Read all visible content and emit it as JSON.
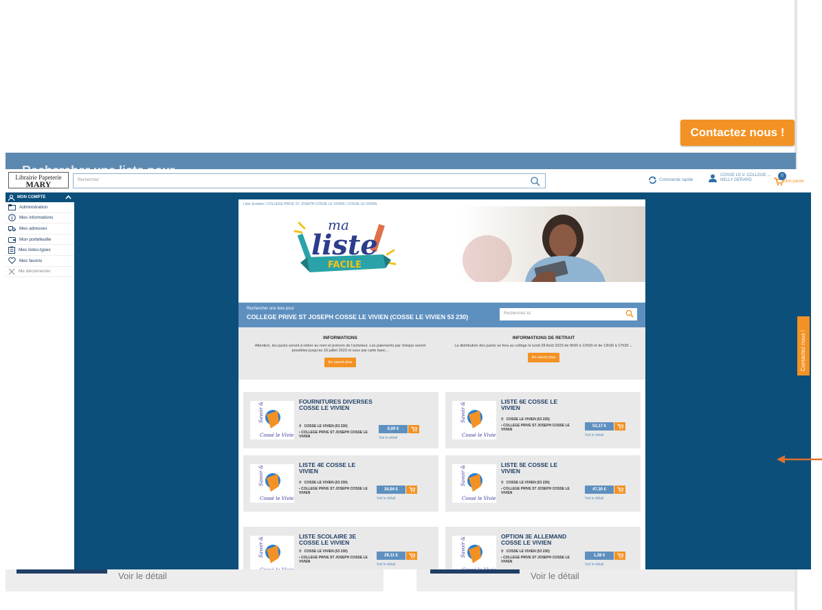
{
  "background": {
    "contact_button": "Contactez nous !",
    "band_heading": "Rechercher une liste pour",
    "bottom_links": [
      "Voir le détail",
      "Voir le détail"
    ]
  },
  "header": {
    "logo_line1": "Librairie Papeterie",
    "logo_line2": "MARY",
    "search_placeholder": "Rechercher",
    "quick_order": "Commande rapide",
    "user_line1": "COSSE LE V. COLLEGE ...",
    "user_line2": "NELLY GERARD",
    "cart_count": "0",
    "cart_label": "Mon panier"
  },
  "sidebar": {
    "header": "MON COMPTE",
    "items": [
      {
        "label": "Administration",
        "icon": "folder-icon"
      },
      {
        "label": "Mes informations",
        "icon": "info-icon"
      },
      {
        "label": "Mes adresses",
        "icon": "truck-icon"
      },
      {
        "label": "Mon portefeuille",
        "icon": "wallet-icon"
      },
      {
        "label": "Mes listes-types",
        "icon": "clipboard-icon"
      },
      {
        "label": "Mes favoris",
        "icon": "heart-icon"
      },
      {
        "label": "Me déconnecter",
        "icon": "close-icon"
      }
    ]
  },
  "main": {
    "breadcrumb": "Liste Scolaire / COLLEGE PRIVE ST JOSEPH COSSE LE VIVIEN / COSSE LE VIVIEN",
    "hero_logo": {
      "ma": "ma",
      "liste": "liste",
      "facile": "FACILE"
    },
    "search_prompt": "Rechercher une liste pour",
    "school_name": "COLLEGE PRIVE ST JOSEPH COSSE LE VIVIEN (COSSE LE VIVIEN 53 230)",
    "search_placeholder": "Recherchez ici",
    "info_left": {
      "title": "INFORMATIONS",
      "text": "Attention, les packs seront à retirer au nom et prénom de l'acheteur. Les paiements par chèque seront possibles jusqu'au 16 juillet 2023 et ceux par carte banc...",
      "button": "En savoir plus"
    },
    "info_right": {
      "title": "INFORMATIONS DE RETRAIT",
      "text": "La distribution des packs se fera au collège le lundi 28 Août 2023 de 9h00 à 12h00 et de 13h30 à 17h30 ...",
      "button": "En savoir plus"
    },
    "list_location": "COSSE LE VIVIEN (53 230)",
    "list_detail": "Voir le détail",
    "lists": [
      {
        "title": "FOURNITURES DIVERSES COSSE LE VIVIEN",
        "school": "COLLEGE PRIVE ST JOSEPH COSSE LE VIVIEN",
        "price": "0,00 €"
      },
      {
        "title": "LISTE 6E COSSE LE VIVIEN",
        "school": "COLLEGE PRIVE ST JOSEPH COSSE LE VIVIEN",
        "price": "53,17 €"
      },
      {
        "title": "LISTE 4E COSSE LE VIVIEN",
        "school": "COLLEGE PRIVE ST JOSEPH COSSE LE VIVIEN",
        "price": "34,94 €"
      },
      {
        "title": "LISTE 5E COSSE LE VIVIEN",
        "school": "COLLEGE PRIVE ST JOSEPH COSSE LE VIVIEN",
        "price": "47,30 €"
      },
      {
        "title": "LISTE SCOLAIRE 3E COSSE LE VIVIEN",
        "school": "COLLEGE PRIVE ST JOSEPH COSSE LE VIVIEN",
        "price": "29,11 €"
      },
      {
        "title": "OPTION 3E ALLEMAND COSSE LE VIVIEN",
        "school": "COLLEGE PRIVE ST JOSEPH COSSE LE VIVIEN",
        "price": "1,38 €"
      }
    ]
  },
  "side_tab": "Contactez nous !",
  "colors": {
    "navy": "#0b4f7a",
    "blue": "#5e90bf",
    "orange": "#f39224",
    "grey": "#e9e9e9"
  }
}
